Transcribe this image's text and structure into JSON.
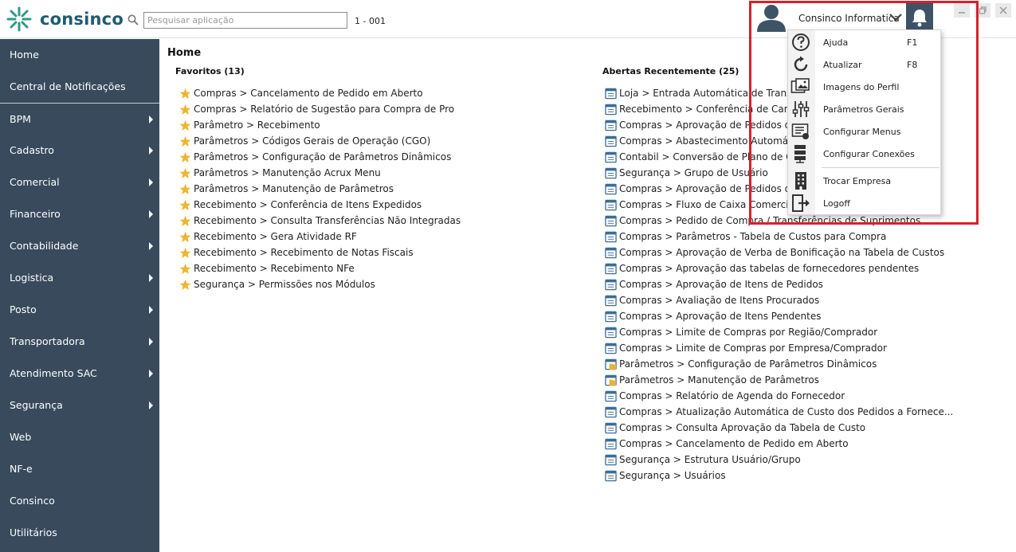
{
  "brand": {
    "name": "consinco",
    "color": "#1f5b74",
    "accent": "#2e9a86"
  },
  "search": {
    "placeholder": "Pesquisar aplicação",
    "value": ""
  },
  "company_code": "1 - 001",
  "user": {
    "name": "Consinco Informatica"
  },
  "icons": {
    "search": "search-icon",
    "user": "user-avatar-icon",
    "chevron": "chevron-down-icon",
    "bell": "bell-icon",
    "star": "star-icon",
    "window": "window-icon",
    "window-folder": "window-folder-icon"
  },
  "colors": {
    "sidebar": "#384a5c",
    "bell_bg": "#3e5366",
    "highlight": "#d7212b",
    "star": "#f0b52e",
    "window_icon": "#3b6e99"
  },
  "sidebar": {
    "items": [
      {
        "label": "Home",
        "submenu": false
      },
      {
        "label": "Central de Notificações",
        "submenu": false
      },
      {
        "label": "BPM",
        "submenu": true
      },
      {
        "label": "Cadastro",
        "submenu": true
      },
      {
        "label": "Comercial",
        "submenu": true
      },
      {
        "label": "Financeiro",
        "submenu": true
      },
      {
        "label": "Contabilidade",
        "submenu": true
      },
      {
        "label": "Logistica",
        "submenu": true
      },
      {
        "label": "Posto",
        "submenu": true
      },
      {
        "label": "Transportadora",
        "submenu": true
      },
      {
        "label": "Atendimento SAC",
        "submenu": true
      },
      {
        "label": "Segurança",
        "submenu": true
      },
      {
        "label": "Web",
        "submenu": false
      },
      {
        "label": "NF-e",
        "submenu": false
      },
      {
        "label": "Consinco",
        "submenu": false
      },
      {
        "label": "Utilitários",
        "submenu": false
      }
    ]
  },
  "main": {
    "title": "Home",
    "favorites": {
      "title": "Favoritos (13)",
      "items": [
        "Compras > Cancelamento de Pedido em Aberto",
        "Compras > Relatório de Sugestão para Compra de Pro",
        "Parâmetro > Recebimento",
        "Parâmetros > Códigos Gerais de Operação (CGO)",
        "Parâmetros > Configuração de Parâmetros Dinâmicos",
        "Parâmetros > Manutenção Acrux Menu",
        "Parâmetros > Manutenção de Parâmetros",
        "Recebimento > Conferência de Itens Expedidos",
        "Recebimento > Consulta Transferências Não Integradas",
        "Recebimento > Gera Atividade RF",
        "Recebimento > Recebimento de Notas Fiscais",
        "Recebimento > Recebimento NFe",
        "Segurança > Permissões nos Módulos"
      ]
    },
    "recent": {
      "title": "Abertas Recentemente (25)",
      "items": [
        {
          "label": "Loja > Entrada Automática de Transferê",
          "icon": "window"
        },
        {
          "label": "Recebimento > Conferência de Carga",
          "icon": "window"
        },
        {
          "label": "Compras > Aprovação de Pedidos de Tr",
          "icon": "window"
        },
        {
          "label": "Compras > Abastecimento Automático",
          "icon": "window"
        },
        {
          "label": "Contabil > Conversão de Plano de Cont",
          "icon": "window"
        },
        {
          "label": "Segurança > Grupo de Usuário",
          "icon": "window"
        },
        {
          "label": "Compras > Aprovação de Pedidos de Co",
          "icon": "window"
        },
        {
          "label": "Compras > Fluxo de Caixa Comercial",
          "icon": "window"
        },
        {
          "label": "Compras > Pedido de Compra / Transferências de Suprimentos",
          "icon": "window"
        },
        {
          "label": "Compras > Parâmetros - Tabela de Custos para Compra",
          "icon": "window"
        },
        {
          "label": "Compras > Aprovação de Verba de Bonificação na Tabela de Custos",
          "icon": "window"
        },
        {
          "label": "Compras > Aprovação das tabelas de fornecedores pendentes",
          "icon": "window"
        },
        {
          "label": "Compras > Aprovação de Itens de Pedidos",
          "icon": "window"
        },
        {
          "label": "Compras > Avaliação de Itens Procurados",
          "icon": "window"
        },
        {
          "label": "Compras > Aprovação de Itens Pendentes",
          "icon": "window"
        },
        {
          "label": "Compras > Limite de Compras por Região/Comprador",
          "icon": "window"
        },
        {
          "label": "Compras > Limite de Compras por Empresa/Comprador",
          "icon": "window"
        },
        {
          "label": "Parâmetros > Configuração de Parâmetros Dinâmicos",
          "icon": "window-folder"
        },
        {
          "label": "Parâmetros > Manutenção de Parâmetros",
          "icon": "window-folder"
        },
        {
          "label": "Compras > Relatório de Agenda do Fornecedor",
          "icon": "window"
        },
        {
          "label": "Compras > Atualização Automática de Custo dos Pedidos a Fornece...",
          "icon": "window"
        },
        {
          "label": "Compras > Consulta Aprovação da Tabela de Custo",
          "icon": "window"
        },
        {
          "label": "Compras > Cancelamento de Pedido em Aberto",
          "icon": "window"
        },
        {
          "label": "Segurança > Estrutura Usuário/Grupo",
          "icon": "window"
        },
        {
          "label": "Segurança > Usuários",
          "icon": "window"
        }
      ]
    }
  },
  "dropdown": {
    "items": [
      {
        "label": "Ajuda",
        "shortcut": "F1",
        "icon": "help-icon"
      },
      {
        "label": "Atualizar",
        "shortcut": "F8",
        "icon": "refresh-icon"
      },
      {
        "label": "Imagens do Perfil",
        "shortcut": "",
        "icon": "profile-images-icon"
      },
      {
        "label": "Parâmetros Gerais",
        "shortcut": "",
        "icon": "sliders-icon"
      },
      {
        "label": "Configurar Menus",
        "shortcut": "",
        "icon": "menu-config-icon"
      },
      {
        "label": "Configurar Conexões",
        "shortcut": "",
        "icon": "server-icon"
      },
      {
        "label": "Trocar Empresa",
        "shortcut": "",
        "icon": "building-icon"
      },
      {
        "label": "Logoff",
        "shortcut": "",
        "icon": "logoff-icon"
      }
    ]
  }
}
